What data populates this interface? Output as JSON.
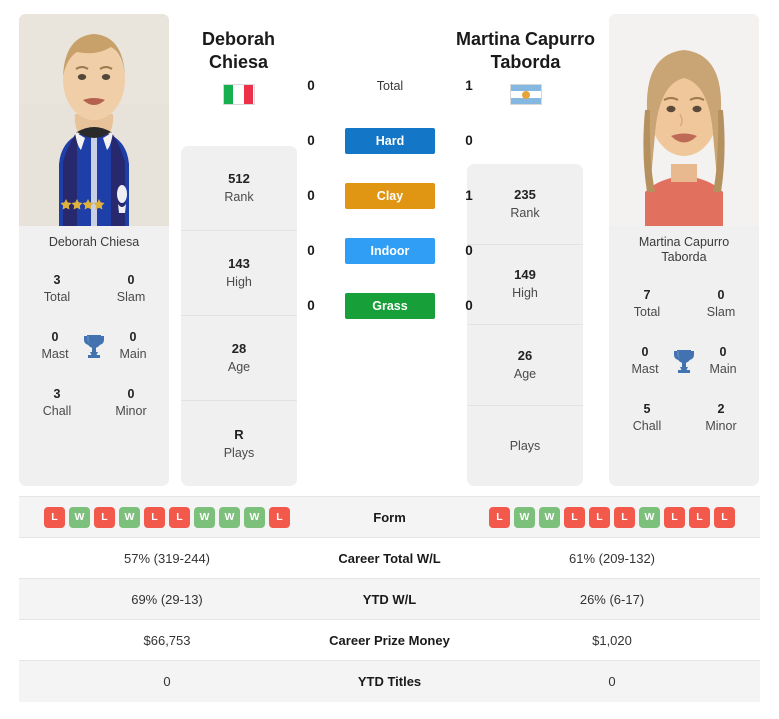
{
  "players": {
    "left": {
      "display_name": "Deborah Chiesa",
      "name_line1": "Deborah",
      "name_line2": "Chiesa",
      "country": "Italy",
      "flag_icon": "flag-italy",
      "rank": "512",
      "rank_label": "Rank",
      "high": "143",
      "high_label": "High",
      "age": "28",
      "age_label": "Age",
      "plays": "R",
      "plays_label": "Plays",
      "titles": {
        "total": "3",
        "total_label": "Total",
        "slam": "0",
        "slam_label": "Slam",
        "mast": "0",
        "mast_label": "Mast",
        "main": "0",
        "main_label": "Main",
        "chall": "3",
        "chall_label": "Chall",
        "minor": "0",
        "minor_label": "Minor"
      },
      "form": [
        "L",
        "W",
        "L",
        "W",
        "L",
        "L",
        "W",
        "W",
        "W",
        "L"
      ],
      "career_wl": "57% (319-244)",
      "ytd_wl": "69% (29-13)",
      "prize_money": "$66,753",
      "ytd_titles": "0"
    },
    "right": {
      "display_name": "Martina Capurro Taborda",
      "name_line1": "Martina Capurro",
      "name_line2": "Taborda",
      "country": "Argentina",
      "flag_icon": "flag-argentina",
      "rank": "235",
      "rank_label": "Rank",
      "high": "149",
      "high_label": "High",
      "age": "26",
      "age_label": "Age",
      "plays": "",
      "plays_label": "Plays",
      "titles": {
        "total": "7",
        "total_label": "Total",
        "slam": "0",
        "slam_label": "Slam",
        "mast": "0",
        "mast_label": "Mast",
        "main": "0",
        "main_label": "Main",
        "chall": "5",
        "chall_label": "Chall",
        "minor": "2",
        "minor_label": "Minor"
      },
      "form": [
        "L",
        "W",
        "W",
        "L",
        "L",
        "L",
        "W",
        "L",
        "L",
        "L"
      ],
      "career_wl": "61% (209-132)",
      "ytd_wl": "26% (6-17)",
      "prize_money": "$1,020",
      "ytd_titles": "0"
    }
  },
  "head_to_head": {
    "rows": [
      {
        "label": "Total",
        "left": "0",
        "right": "1",
        "color": ""
      },
      {
        "label": "Hard",
        "left": "0",
        "right": "0",
        "color": "#1476c6"
      },
      {
        "label": "Clay",
        "left": "0",
        "right": "1",
        "color": "#e09612"
      },
      {
        "label": "Indoor",
        "left": "0",
        "right": "0",
        "color": "#2f9ef4"
      },
      {
        "label": "Grass",
        "left": "0",
        "right": "0",
        "color": "#17a03a"
      }
    ]
  },
  "comparison_table": {
    "rows": [
      {
        "label": "Form",
        "type": "form"
      },
      {
        "label": "Career Total W/L",
        "type": "text",
        "left": "57% (319-244)",
        "right": "61% (209-132)"
      },
      {
        "label": "YTD W/L",
        "type": "text",
        "left": "69% (29-13)",
        "right": "26% (6-17)"
      },
      {
        "label": "Career Prize Money",
        "type": "text",
        "left": "$66,753",
        "right": "$1,020"
      },
      {
        "label": "YTD Titles",
        "type": "text",
        "left": "0",
        "right": "0"
      }
    ]
  },
  "colors": {
    "hard": "#1476c6",
    "clay": "#e09612",
    "indoor": "#2f9ef4",
    "grass": "#17a03a",
    "win": "#7cc07c",
    "loss": "#f2594b",
    "trophy": "#4273b0"
  }
}
